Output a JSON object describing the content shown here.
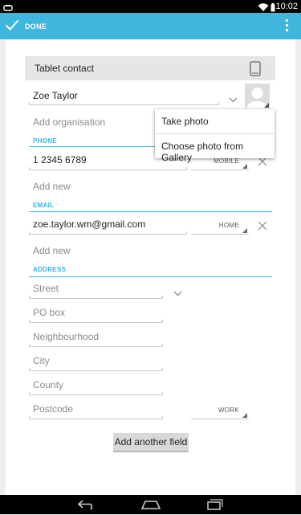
{
  "status_bar": {
    "time": "10:02"
  },
  "action_bar": {
    "done_label": "DONE"
  },
  "account": {
    "label": "Tablet contact"
  },
  "name": {
    "value": "Zoe Taylor"
  },
  "organisation": {
    "placeholder": "Add organisation"
  },
  "photo_menu": {
    "items": [
      "Take photo",
      "Choose photo from Gallery"
    ]
  },
  "phone": {
    "section": "PHONE",
    "value": "1 2345 6789",
    "type": "MOBILE",
    "add_new": "Add new"
  },
  "email": {
    "section": "EMAIL",
    "value": "zoe.taylor.wm@gmail.com",
    "type": "HOME",
    "add_new": "Add new"
  },
  "address": {
    "section": "ADDRESS",
    "street": "Street",
    "po_box": "PO box",
    "neighbourhood": "Neighbourhood",
    "city": "City",
    "county": "County",
    "postcode": "Postcode",
    "type": "WORK"
  },
  "add_field_label": "Add another field",
  "colors": {
    "accent": "#33b5e5",
    "action_bar": "#40b6dd"
  }
}
